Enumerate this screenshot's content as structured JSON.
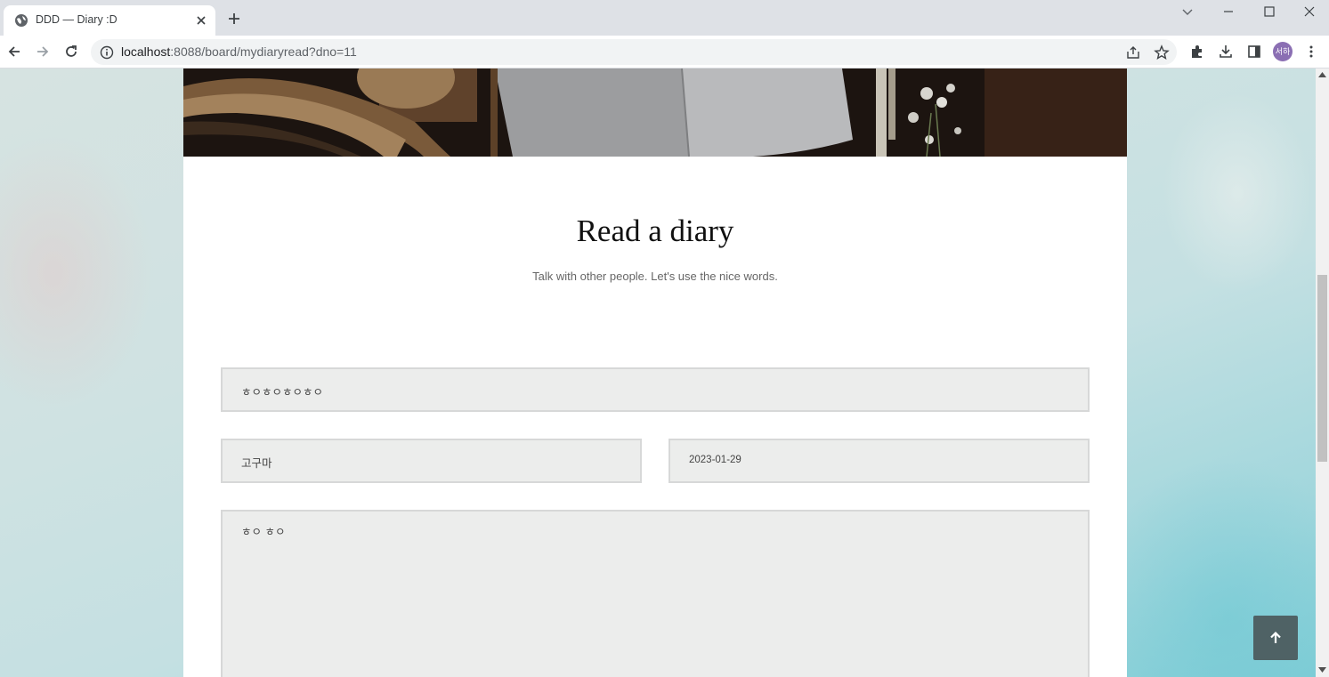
{
  "browser": {
    "tab_title": "DDD — Diary :D",
    "url_host": "localhost",
    "url_rest": ":8088/board/mydiaryread?dno=11",
    "profile_label": "서하"
  },
  "page": {
    "title": "Read a diary",
    "subtitle": "Talk with other people. Let's use the nice words."
  },
  "form": {
    "title_value": "ㅎㅇㅎㅇㅎㅇㅎㅇ",
    "writer_value": "고구마",
    "date_value": "2023-01-29",
    "content_value": "ㅎㅇ ㅎㅇ"
  },
  "colors": {
    "accent": "#4f6265",
    "field_bg": "#ecedec"
  }
}
